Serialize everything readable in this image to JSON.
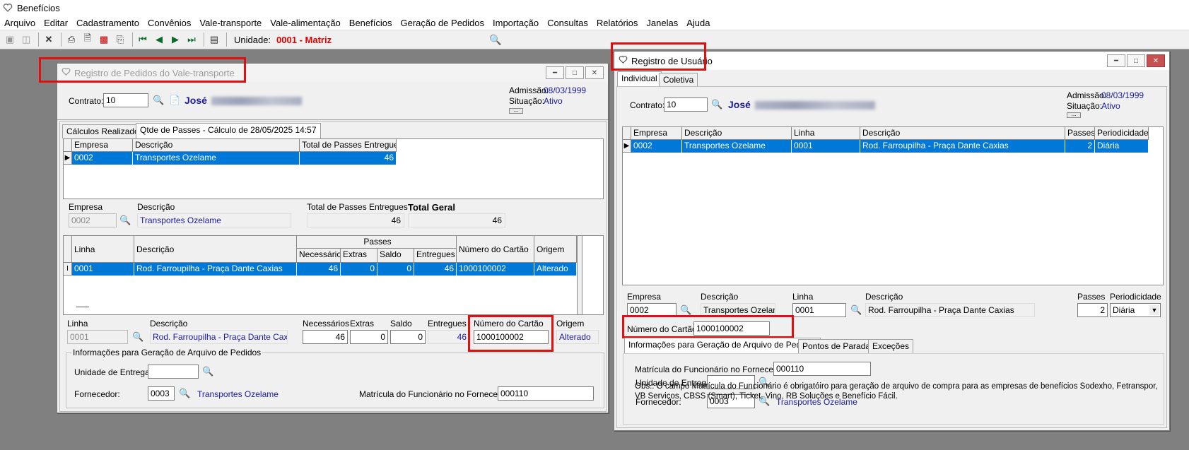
{
  "app": {
    "title": "Benefícios"
  },
  "menu": [
    "Arquivo",
    "Editar",
    "Cadastramento",
    "Convênios",
    "Vale-transporte",
    "Vale-alimentação",
    "Benefícios",
    "Geração de Pedidos",
    "Importação",
    "Consultas",
    "Relatórios",
    "Janelas",
    "Ajuda"
  ],
  "toolbar": {
    "unit_label": "Unidade:",
    "unit_value": "0001 - Matriz"
  },
  "left_window": {
    "title": "Registro de Pedidos do Vale-transporte",
    "contract_label": "Contrato:",
    "contract_value": "10",
    "employee_first_name": "José",
    "admission_label": "Admissão:",
    "admission_value": "08/03/1999",
    "situation_label": "Situação:",
    "situation_value": "Ativo",
    "tabs": [
      "Cálculos Realizados",
      "Qtde de Passes - Cálculo de 28/05/2025 14:57"
    ],
    "grid1": {
      "headers": [
        "Empresa",
        "Descrição",
        "Total de Passes Entregues"
      ],
      "rows": [
        [
          "0002",
          "Transportes Ozelame",
          "46"
        ]
      ]
    },
    "detail1": {
      "empresa_label": "Empresa",
      "empresa_value": "0002",
      "descricao_label": "Descrição",
      "descricao_value": "Transportes Ozelame",
      "total_label": "Total de Passes Entregues",
      "total_value": "46",
      "geral_label": "Total Geral",
      "geral_value": "46"
    },
    "grid2": {
      "group_header": "Passes",
      "headers": [
        "Linha",
        "Descrição",
        "Necessários",
        "Extras",
        "Saldo",
        "Entregues",
        "Número do Cartão",
        "Origem"
      ],
      "rows": [
        [
          "0001",
          "Rod. Farroupilha - Praça Dante Caxias",
          "46",
          "0",
          "0",
          "46",
          "1000100002",
          "Alterado"
        ]
      ]
    },
    "detail2": {
      "linha_label": "Linha",
      "linha_value": "0001",
      "descricao_label": "Descrição",
      "descricao_value": "Rod. Farroupilha - Praça Dante Caxias",
      "nec_label": "Necessários",
      "nec_value": "46",
      "extras_label": "Extras",
      "extras_value": "0",
      "saldo_label": "Saldo",
      "saldo_value": "0",
      "entregues_label": "Entregues",
      "entregues_value": "46",
      "cartao_label": "Número do Cartão",
      "cartao_value": "1000100002",
      "origem_label": "Origem",
      "origem_value": "Alterado"
    },
    "geracao": {
      "legend": "Informações para Geração de Arquivo de Pedidos",
      "unidade_label": "Unidade de Entrega:",
      "unidade_value": "",
      "fornecedor_label": "Fornecedor:",
      "fornecedor_value": "0003",
      "fornecedor_name": "Transportes Ozelame",
      "matricula_label": "Matrícula do Funcionário no Fornecedor:",
      "matricula_value": "000110"
    }
  },
  "right_window": {
    "title": "Registro de Usuário",
    "tabs": [
      "Individual",
      "Coletiva"
    ],
    "contract_label": "Contrato:",
    "contract_value": "10",
    "employee_first_name": "José",
    "admission_label": "Admissão:",
    "admission_value": "08/03/1999",
    "situation_label": "Situação:",
    "situation_value": "Ativo",
    "grid": {
      "headers": [
        "Empresa",
        "Descrição",
        "Linha",
        "Descrição",
        "Passes",
        "Periodicidade"
      ],
      "rows": [
        [
          "0002",
          "Transportes Ozelame",
          "0001",
          "Rod. Farroupilha - Praça Dante Caxias",
          "2",
          "Diária"
        ]
      ]
    },
    "detail": {
      "empresa_label": "Empresa",
      "empresa_value": "0002",
      "descricao_label": "Descrição",
      "descricao_value": "Transportes Ozelame",
      "linha_label": "Linha",
      "linha_value": "0001",
      "linha_desc_label": "Descrição",
      "linha_desc_value": "Rod. Farroupilha - Praça Dante Caxias",
      "passes_label": "Passes",
      "passes_value": "2",
      "periodicidade_label": "Periodicidade",
      "periodicidade_value": "Diária",
      "cartao_label": "Número do Cartão:",
      "cartao_value": "1000100002"
    },
    "subtabs": [
      "Informações para Geração de Arquivo de Pedidos",
      "Pontos de Parada",
      "Exceções"
    ],
    "geracao": {
      "unidade_label": "Unidade de Entrega:",
      "unidade_value": "",
      "fornecedor_label": "Fornecedor:",
      "fornecedor_value": "0003",
      "fornecedor_name": "Transportes Ozelame",
      "matricula_label": "Matrícula do Funcionário no Fornecedor:",
      "matricula_value": "000110",
      "obs_line1": "Obs.: O campo Matrícula do Funcionário é obrigatóiro para geração de arquivo de compra para as empresas de benefícios Sodexho, Fetranspor,",
      "obs_line2": "VB Serviços, CBSS (Smart), Ticket, Vino, RB Soluções e Benefício Fácil."
    }
  },
  "colors": {
    "selection": "#0078d7",
    "highlight_box": "#e01010",
    "link_blue": "#1a1aa0",
    "unit_red": "#e00000"
  }
}
